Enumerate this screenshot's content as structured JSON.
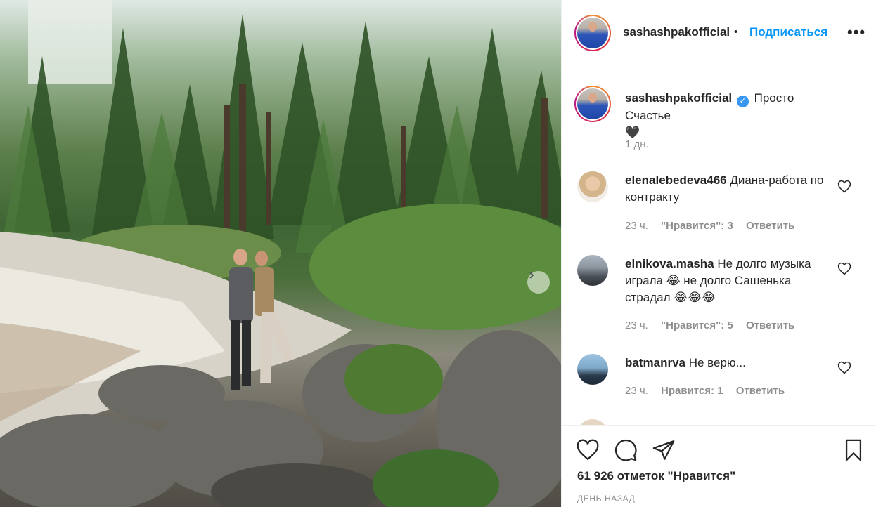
{
  "post": {
    "author": "sashashpakofficial",
    "follow_label": "Подписаться",
    "header_separator": "•",
    "more_label": "•••",
    "caption_text": "Просто Счастье",
    "caption_emoji": "🖤",
    "caption_time": "1 дн.",
    "verified_icon": "check-badge-icon"
  },
  "comments": [
    {
      "user": "elenalebedeva466",
      "text": "Диана-работа по контракту",
      "time": "23 ч.",
      "likes": "\"Нравится\": 3",
      "reply": "Ответить"
    },
    {
      "user": "elnikova.masha",
      "text": "Не долго музыка играла 😂 не долго Сашенька страдал 😂😂😂",
      "time": "23 ч.",
      "likes": "\"Нравится\": 5",
      "reply": "Ответить"
    },
    {
      "user": "batmanrva",
      "text": "Не верю...",
      "time": "23 ч.",
      "likes": "Нравится: 1",
      "reply": "Ответить"
    }
  ],
  "actions": {
    "like_icon": "heart-icon",
    "comment_icon": "comment-icon",
    "share_icon": "paper-plane-icon",
    "save_icon": "bookmark-icon",
    "likes_text": "61 926 отметок \"Нравится\"",
    "date_text": "ДЕНЬ НАЗАД"
  },
  "colors": {
    "follow_blue": "#0095f6",
    "meta_gray": "#8e8e8e",
    "text": "#262626"
  }
}
